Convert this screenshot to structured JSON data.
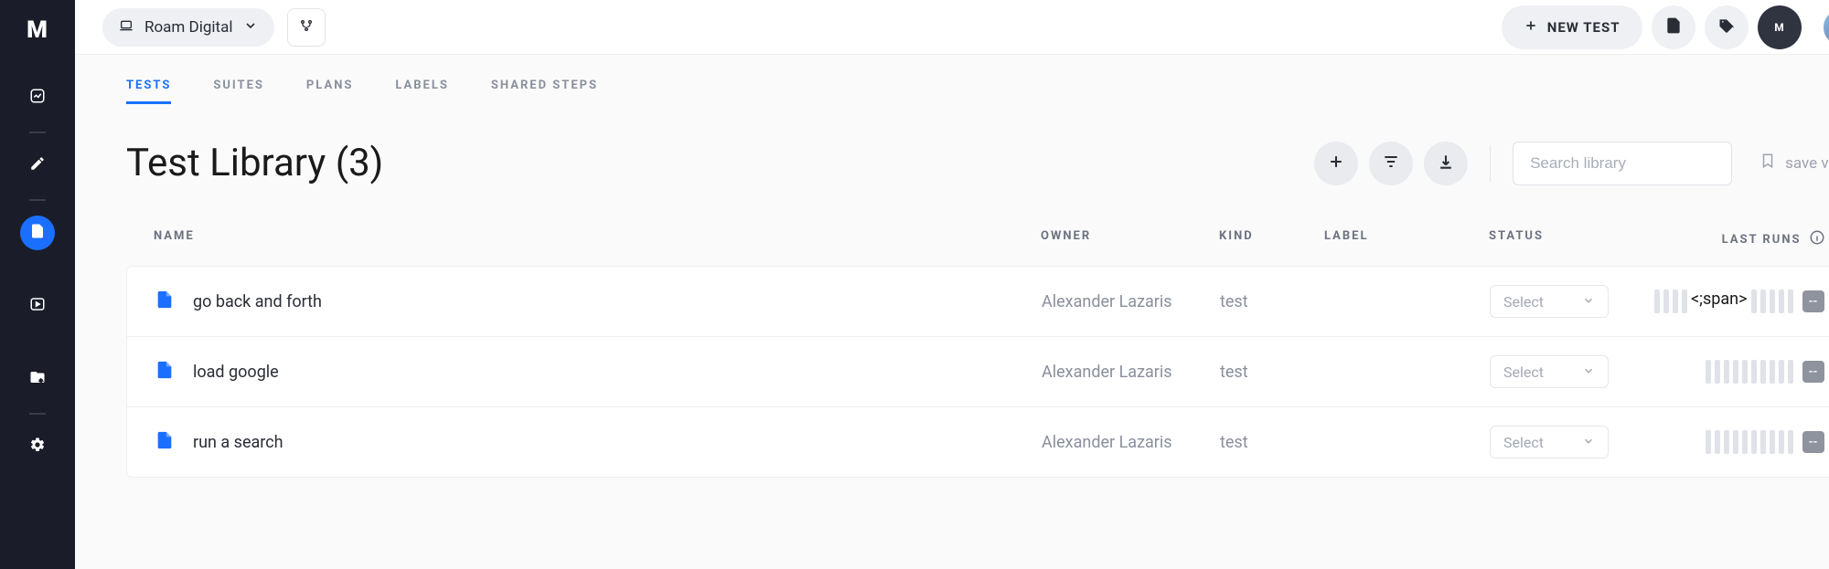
{
  "project": {
    "name": "Roam Digital"
  },
  "topbar": {
    "new_test_label": "NEW TEST"
  },
  "tabs": [
    {
      "label": "TESTS",
      "active": true
    },
    {
      "label": "SUITES",
      "active": false
    },
    {
      "label": "PLANS",
      "active": false
    },
    {
      "label": "LABELS",
      "active": false
    },
    {
      "label": "SHARED STEPS",
      "active": false
    }
  ],
  "library": {
    "title": "Test Library (3)",
    "search_placeholder": "Search library",
    "save_view_label": "save view"
  },
  "columns": {
    "name": "NAME",
    "owner": "OWNER",
    "kind": "KIND",
    "label": "LABEL",
    "status": "STATUS",
    "last_runs": "LAST RUNS"
  },
  "status_select_placeholder": "Select",
  "run_badge": "--",
  "tests": [
    {
      "name": "go back and forth",
      "owner": "Alexander Lazaris",
      "kind": "test",
      "label": "",
      "status": ""
    },
    {
      "name": "load google",
      "owner": "Alexander Lazaris",
      "kind": "test",
      "label": "",
      "status": ""
    },
    {
      "name": "run a search",
      "owner": "Alexander Lazaris",
      "kind": "test",
      "label": "",
      "status": ""
    }
  ]
}
